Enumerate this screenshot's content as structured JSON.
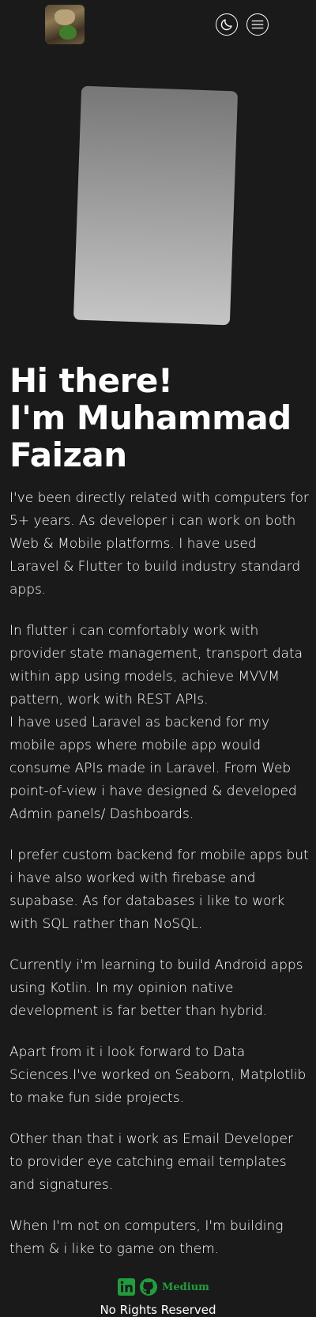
{
  "header": {
    "avatar_alt": "profile avatar",
    "theme_icon": "moon-icon",
    "menu_icon": "hamburger-menu-icon"
  },
  "hero": {
    "title_line1": "Hi there!",
    "title_line2": "I'm Muhammad",
    "title_line3": "Faizan"
  },
  "bio": {
    "p1": "I've been directly related with computers for 5+ years. As developer i can work on both Web & Mobile platforms. I have used Laravel & Flutter to build industry standard apps.",
    "p2a": "In flutter i can comfortably work with provider state management, transport data within app using models, achieve MVVM pattern, work with REST APIs.",
    "p2b": "I have used Laravel as backend for my mobile apps where mobile app would consume APIs made in Laravel. From Web point-of-view i have designed & developed Admin panels/ Dashboards.",
    "p3": "I prefer custom backend for mobile apps but i have also worked with firebase and supabase. As for databases i like to work with SQL rather than NoSQL.",
    "p4": "Currently i'm learning to build Android apps using Kotlin. In my opinion native development is far better than hybrid.",
    "p5": "Apart from it i look forward to Data Sciences.I've worked on Seaborn, Matplotlib to make fun side projects.",
    "p6": "Other than that i work as Email Developer to provider eye catching email templates and signatures.",
    "p7": "When I'm not on computers, I'm building them & i like to game on them."
  },
  "footer": {
    "medium_label": "Medium",
    "rights": "No Rights Reserved",
    "accent_color": "#1f9e3c"
  }
}
